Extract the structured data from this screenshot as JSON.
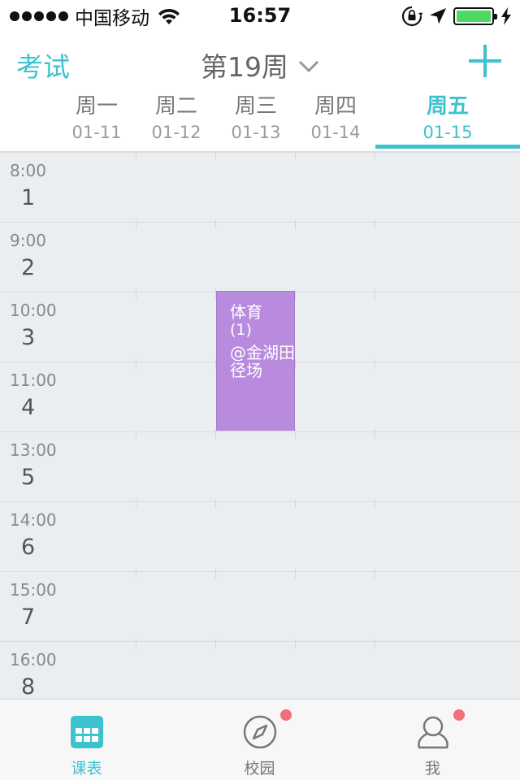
{
  "status_bar": {
    "carrier": "中国移动",
    "time": "16:57",
    "battery_level": 1.0,
    "battery_color": "#4cd964"
  },
  "nav": {
    "exam_label": "考试",
    "week_label": "第19周",
    "add_icon": "plus-icon",
    "dropdown_icon": "chevron-down-icon"
  },
  "days": [
    {
      "name": "周一",
      "date": "01-11"
    },
    {
      "name": "周二",
      "date": "01-12"
    },
    {
      "name": "周三",
      "date": "01-13"
    },
    {
      "name": "周四",
      "date": "01-14"
    },
    {
      "name": "周五",
      "date": "01-15"
    }
  ],
  "active_day_index": 4,
  "slots": [
    {
      "time": "8:00",
      "num": "1"
    },
    {
      "time": "9:00",
      "num": "2"
    },
    {
      "time": "10:00",
      "num": "3"
    },
    {
      "time": "11:00",
      "num": "4"
    },
    {
      "time": "13:00",
      "num": "5"
    },
    {
      "time": "14:00",
      "num": "6"
    },
    {
      "time": "15:00",
      "num": "7"
    },
    {
      "time": "16:00",
      "num": "8"
    }
  ],
  "course": {
    "title": "体育",
    "sub": "(1)",
    "location": "@金湖田径场",
    "color": "#b98bdf"
  },
  "tabs": [
    {
      "label": "课表",
      "icon": "timetable-icon",
      "badge": false
    },
    {
      "label": "校园",
      "icon": "compass-icon",
      "badge": true
    },
    {
      "label": "我",
      "icon": "profile-icon",
      "badge": true
    }
  ],
  "colors": {
    "accent": "#3cc3cf",
    "badge": "#f2707e",
    "grid_bg": "#ebeef0"
  }
}
